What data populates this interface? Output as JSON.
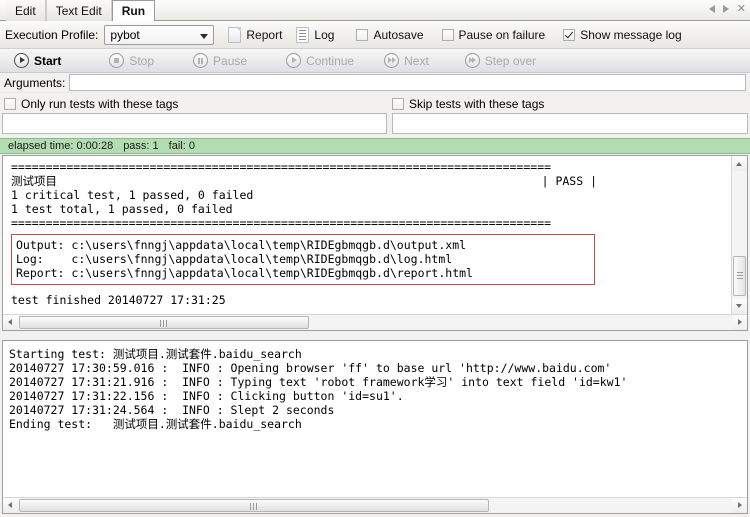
{
  "window": {
    "tabs": [
      {
        "label": "Edit",
        "active": false
      },
      {
        "label": "Text Edit",
        "active": false
      },
      {
        "label": "Run",
        "active": true
      }
    ],
    "nav": {
      "prev": "◁",
      "next": "▷",
      "close": "✕"
    }
  },
  "toolbar": {
    "execution_profile_label": "Execution Profile:",
    "execution_profile_value": "pybot",
    "execution_profile_options": [
      "pybot"
    ],
    "report_label": "Report",
    "log_label": "Log",
    "autosave_label": "Autosave",
    "autosave_checked": false,
    "pause_on_failure_label": "Pause on failure",
    "pause_on_failure_checked": false,
    "show_message_log_label": "Show message log",
    "show_message_log_checked": true
  },
  "transport": [
    {
      "label": "Start",
      "icon": "play-icon",
      "enabled": true
    },
    {
      "label": "Stop",
      "icon": "stop-icon",
      "enabled": false
    },
    {
      "label": "Pause",
      "icon": "pause-icon",
      "enabled": false
    },
    {
      "label": "Continue",
      "icon": "play-icon",
      "enabled": false
    },
    {
      "label": "Next",
      "icon": "next-icon",
      "enabled": false
    },
    {
      "label": "Step over",
      "icon": "step-over-icon",
      "enabled": false
    }
  ],
  "arguments": {
    "label": "Arguments:",
    "value": "",
    "placeholder": ""
  },
  "tags": {
    "include_label": "Only run tests with these tags",
    "include_checked": false,
    "include_value": "",
    "exclude_label": "Skip tests with these tags",
    "exclude_checked": false,
    "exclude_value": ""
  },
  "status": {
    "elapsed": "elapsed time: 0:00:28",
    "pass": "pass: 1",
    "fail": "fail: 0",
    "background_color": "#b3dcb3"
  },
  "output_console": {
    "separator_top": "==============================================================================",
    "suite_name": "测试项目",
    "suite_verdict": "| PASS |",
    "critical_summary": "1 critical test, 1 passed, 0 failed",
    "total_summary": "1 test total, 1 passed, 0 failed",
    "separator_bottom": "==============================================================================",
    "result_box_border_color": "#c24b4b",
    "result_files": [
      {
        "key": "Output: ",
        "path": "c:\\users\\fnngj\\appdata\\local\\temp\\RIDEgbmqgb.d\\output.xml"
      },
      {
        "key": "Log:    ",
        "path": "c:\\users\\fnngj\\appdata\\local\\temp\\RIDEgbmqgb.d\\log.html"
      },
      {
        "key": "Report: ",
        "path": "c:\\users\\fnngj\\appdata\\local\\temp\\RIDEgbmqgb.d\\report.html"
      }
    ],
    "finished_line": "test finished 20140727 17:31:25"
  },
  "message_log": {
    "lines": [
      "Starting test: 测试项目.测试套件.baidu_search",
      "20140727 17:30:59.016 :  INFO : Opening browser 'ff' to base url 'http://www.baidu.com'",
      "20140727 17:31:21.916 :  INFO : Typing text 'robot framework学习' into text field 'id=kw1'",
      "20140727 17:31:22.156 :  INFO : Clicking button 'id=su1'.",
      "20140727 17:31:24.564 :  INFO : Slept 2 seconds",
      "Ending test:   测试项目.测试套件.baidu_search"
    ]
  }
}
